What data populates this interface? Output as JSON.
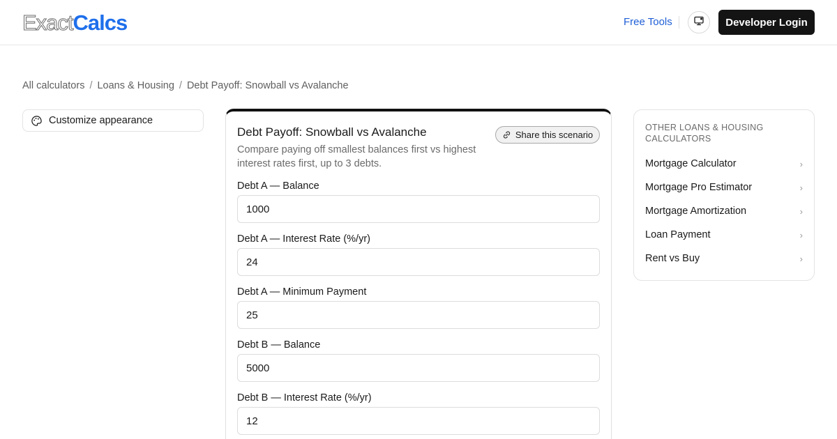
{
  "logo": {
    "light": "Exact",
    "bold": "Calcs"
  },
  "header": {
    "free_tools": "Free Tools",
    "developer_login": "Developer Login",
    "monitor_icon": "monitor-icon"
  },
  "breadcrumb": {
    "items": [
      "All calculators",
      "Loans & Housing",
      "Debt Payoff: Snowball vs Avalanche"
    ],
    "separator": "/"
  },
  "customize": {
    "label": "Customize appearance",
    "icon": "palette-icon"
  },
  "calculator": {
    "title": "Debt Payoff: Snowball vs Avalanche",
    "description": "Compare paying off smallest balances first vs highest interest rates first, up to 3 debts.",
    "share_label": "Share this scenario",
    "share_icon": "link-icon",
    "fields": [
      {
        "label": "Debt A — Balance",
        "value": "1000"
      },
      {
        "label": "Debt A — Interest Rate (%/yr)",
        "value": "24"
      },
      {
        "label": "Debt A — Minimum Payment",
        "value": "25"
      },
      {
        "label": "Debt B — Balance",
        "value": "5000"
      },
      {
        "label": "Debt B — Interest Rate (%/yr)",
        "value": "12"
      }
    ]
  },
  "sidebar": {
    "heading": "OTHER LOANS & HOUSING CALCULATORS",
    "items": [
      {
        "label": "Mortgage Calculator"
      },
      {
        "label": "Mortgage Pro Estimator"
      },
      {
        "label": "Mortgage Amortization"
      },
      {
        "label": "Loan Payment"
      },
      {
        "label": "Rent vs Buy"
      }
    ],
    "chevron": "›"
  },
  "colors": {
    "brand": "#1f6feb",
    "link": "#1f5fd6",
    "dark_button": "#141414"
  }
}
